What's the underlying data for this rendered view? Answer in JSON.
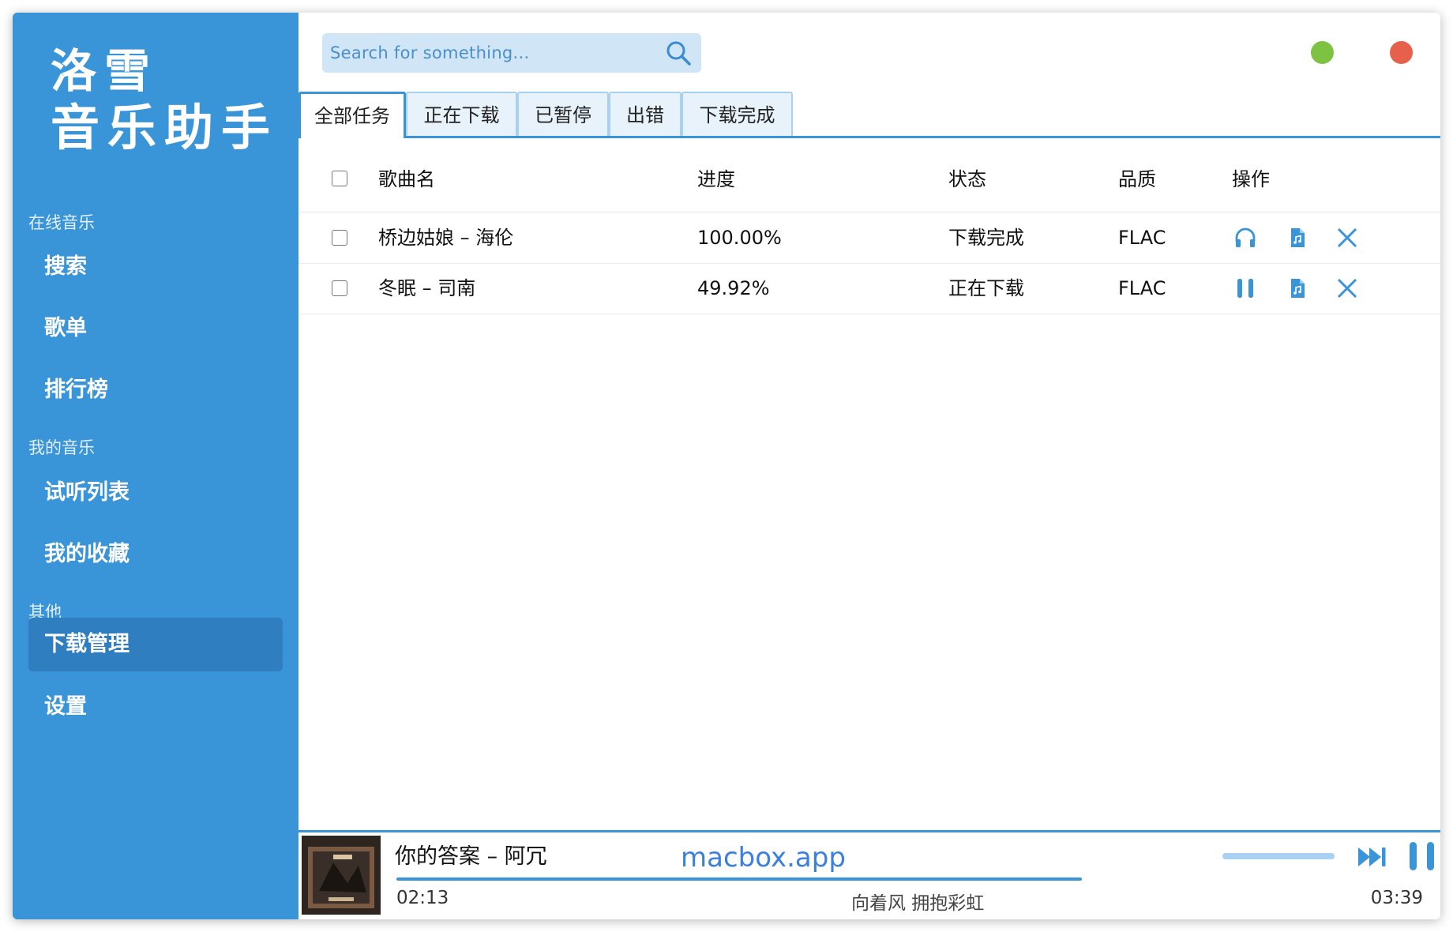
{
  "app": {
    "logo_line1": "洛雪",
    "logo_line2": "音乐助手"
  },
  "sidebar": {
    "groups": [
      {
        "label": "在线音乐"
      },
      {
        "label": "我的音乐"
      },
      {
        "label": "其他"
      }
    ],
    "items": [
      {
        "label": "搜索"
      },
      {
        "label": "歌单"
      },
      {
        "label": "排行榜"
      },
      {
        "label": "试听列表"
      },
      {
        "label": "我的收藏"
      },
      {
        "label": "下载管理",
        "active": true
      },
      {
        "label": "设置"
      }
    ]
  },
  "search": {
    "placeholder": "Search for something..."
  },
  "window_controls": {
    "minimize_color": "#7ec242",
    "close_color": "#e6604c"
  },
  "tabs": [
    {
      "label": "全部任务",
      "active": true
    },
    {
      "label": "正在下载"
    },
    {
      "label": "已暂停"
    },
    {
      "label": "出错"
    },
    {
      "label": "下载完成"
    }
  ],
  "table": {
    "columns": [
      "歌曲名",
      "进度",
      "状态",
      "品质",
      "操作"
    ],
    "rows": [
      {
        "name": "桥边姑娘 – 海伦",
        "progress": "100.00%",
        "status": "下载完成",
        "quality": "FLAC",
        "actions": [
          "headphones-icon",
          "music-file-icon",
          "close-icon"
        ]
      },
      {
        "name": "冬眠 – 司南",
        "progress": "49.92%",
        "status": "正在下载",
        "quality": "FLAC",
        "actions": [
          "pause-icon",
          "music-file-icon",
          "close-icon"
        ]
      }
    ]
  },
  "player": {
    "song": "你的答案 – 阿冗",
    "watermark": "macbox.app",
    "current_time": "02:13",
    "total_time": "03:39",
    "lyric": "向着风 拥抱彩虹",
    "progress": 0.607,
    "volume": 1.0
  },
  "colors": {
    "accent": "#3a94d8",
    "sidebar": "#3a94d8",
    "active_nav": "#2f7fc0"
  }
}
